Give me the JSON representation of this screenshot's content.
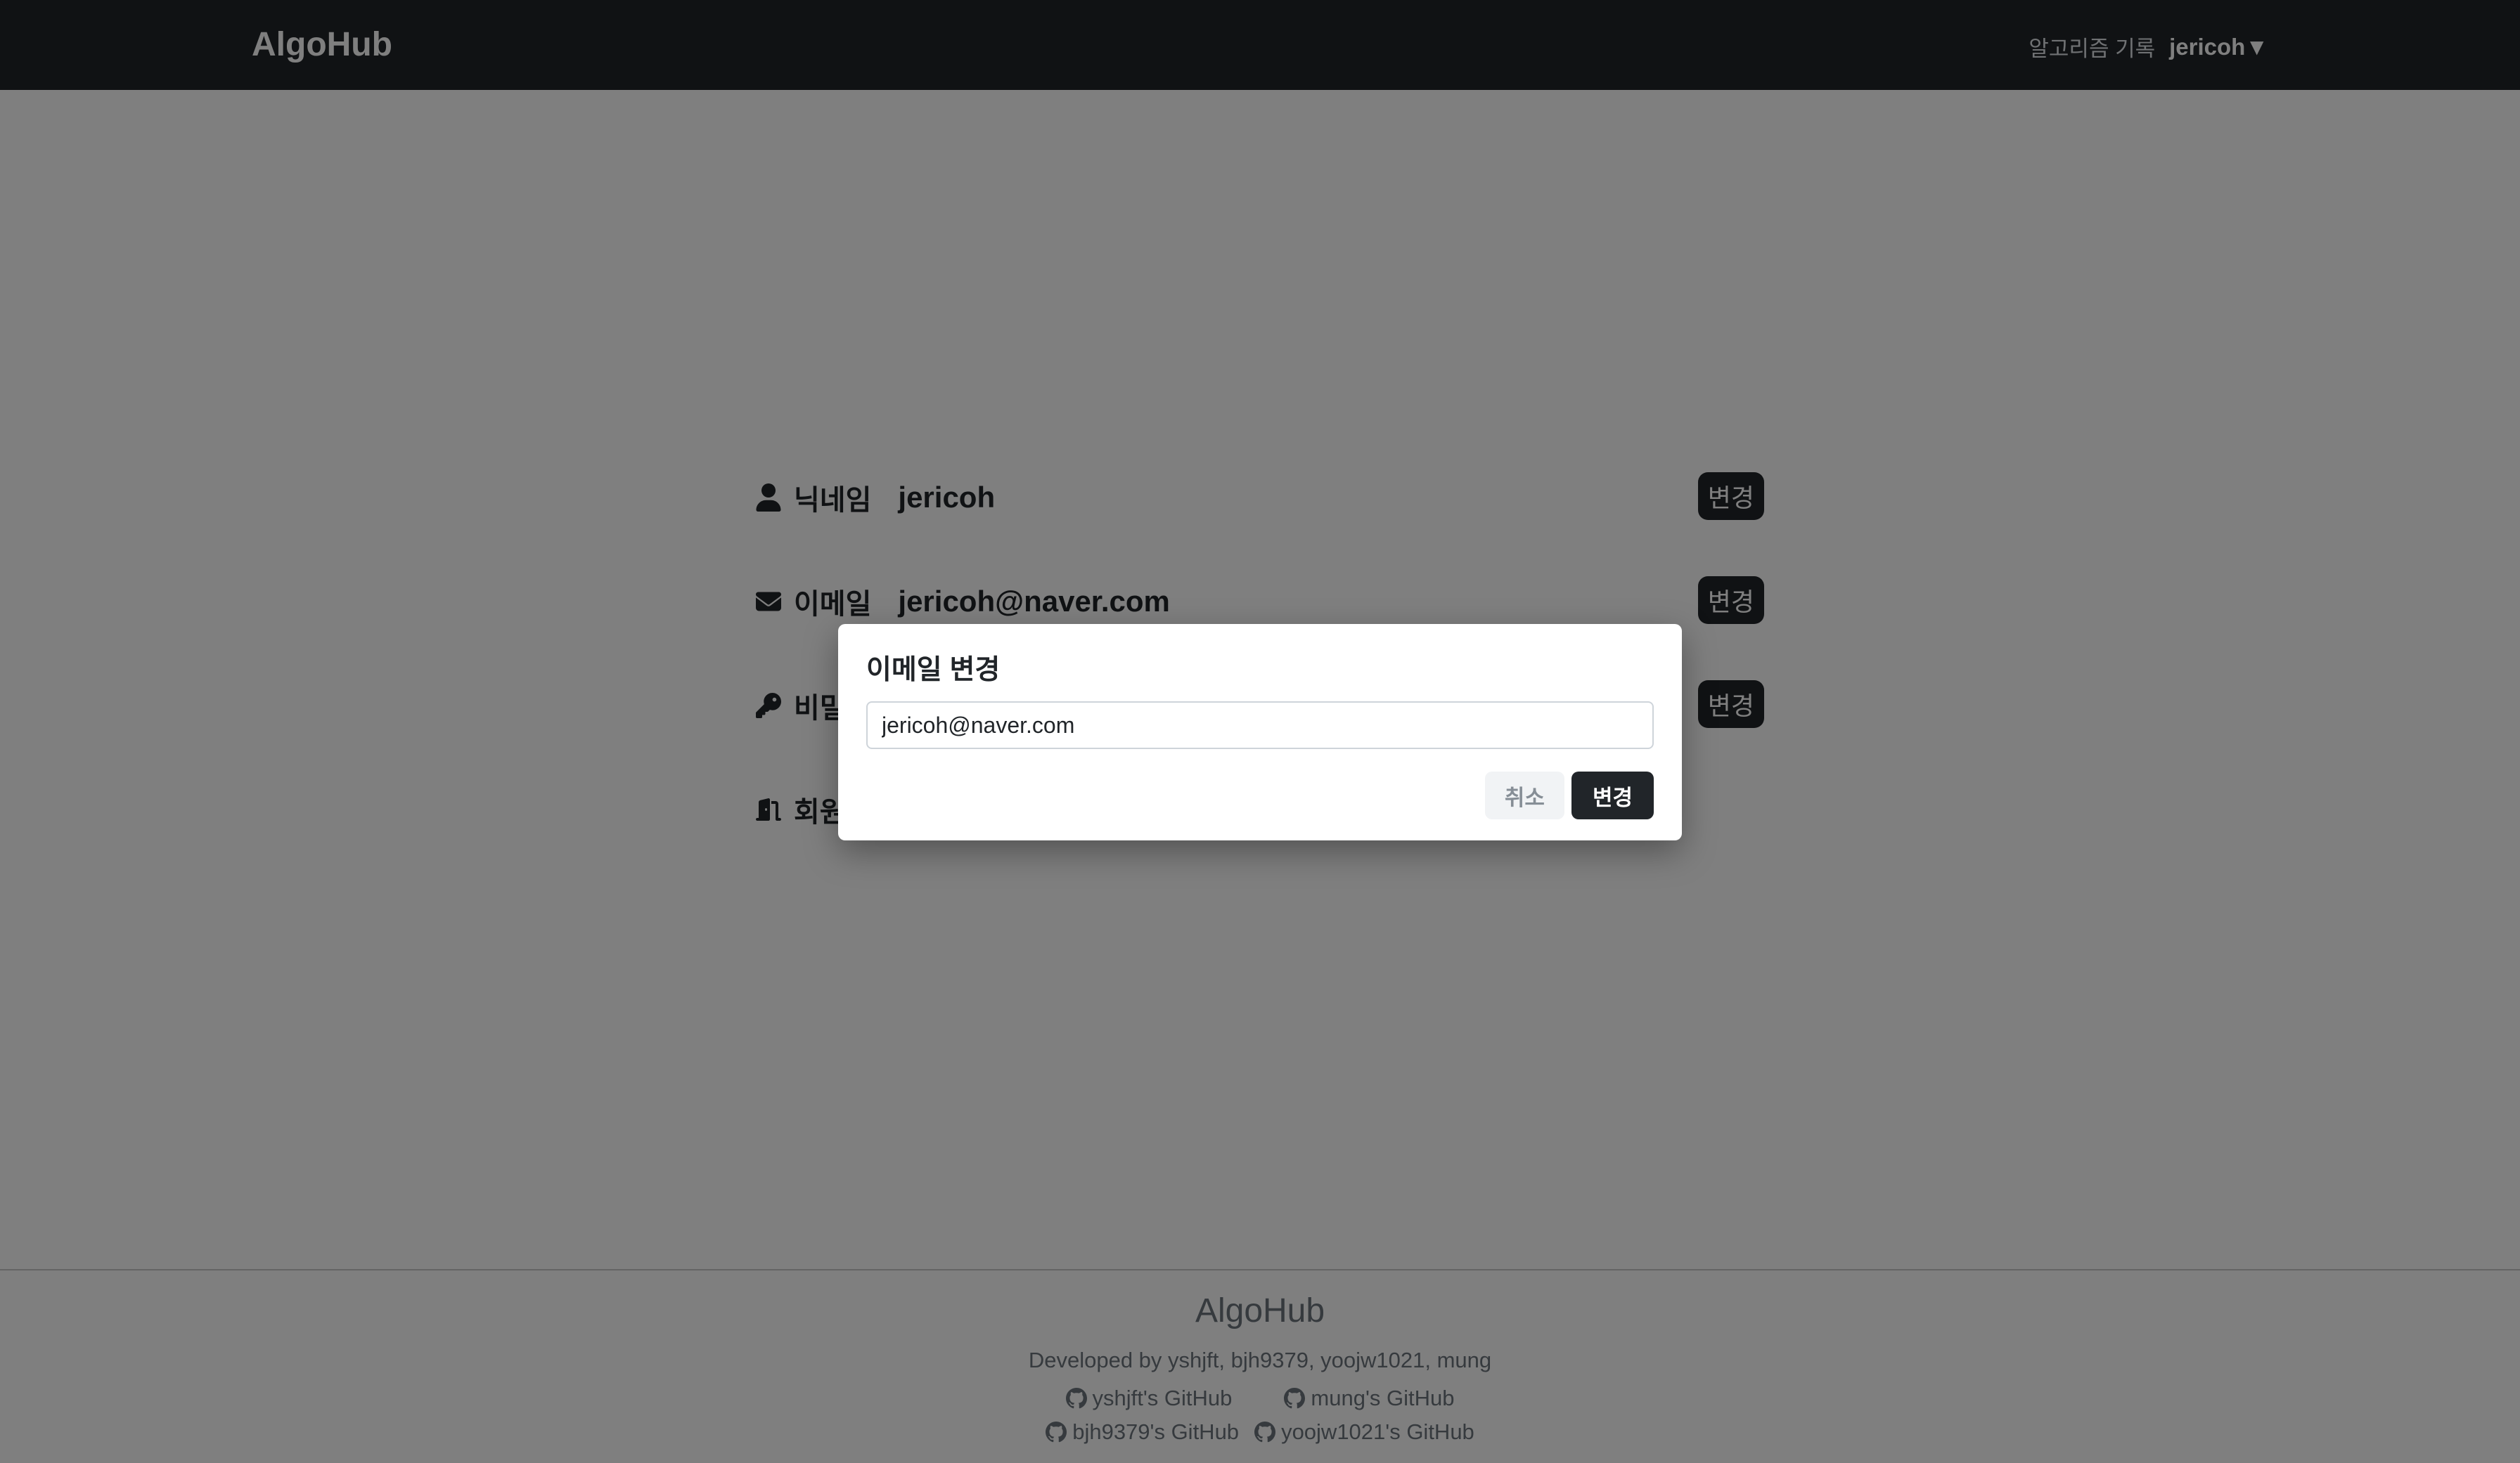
{
  "navbar": {
    "brand": "AlgoHub",
    "links": {
      "algorithm_record": "알고리즘 기록"
    },
    "user_menu": "jericoh▼"
  },
  "profile": {
    "nickname": {
      "icon": "user-icon",
      "label": "닉네임",
      "value": "jericoh",
      "button": "변경"
    },
    "email": {
      "icon": "envelope-icon",
      "label": "이메일",
      "value": "jericoh@naver.com",
      "button": "변경"
    },
    "password": {
      "icon": "key-icon",
      "label": "비밀",
      "button": "변경"
    },
    "withdraw": {
      "icon": "door-exit-icon",
      "label": "회원"
    }
  },
  "modal": {
    "title": "이메일 변경",
    "input_value": "jericoh@naver.com",
    "cancel_label": "취소",
    "confirm_label": "변경"
  },
  "footer": {
    "title": "AlgoHub",
    "developers": "Developed by yshjft, bjh9379, yoojw1021, mung",
    "links_row1": [
      "yshjft's GitHub",
      "mung's GitHub"
    ],
    "links_row2": [
      "bjh9379's GitHub",
      "yoojw1021's GitHub"
    ],
    "link_icon": "github-icon"
  }
}
